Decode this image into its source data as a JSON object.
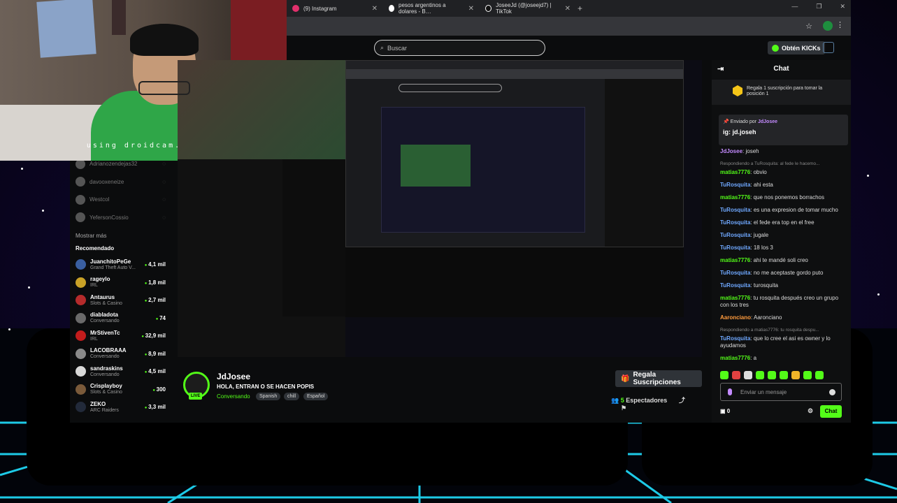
{
  "webcam": {
    "caption": "using droidcam.app"
  },
  "browser": {
    "tabs": [
      {
        "label": "(9) Instagram",
        "icon": "instagram-icon"
      },
      {
        "label": "pesos argentinos a dolares - B…",
        "icon": "google-icon"
      },
      {
        "label": "JoseeJd (@joseejd7) | TikTok",
        "icon": "tiktok-icon"
      }
    ],
    "new_tab": "+"
  },
  "header": {
    "search_placeholder": "Buscar",
    "kicks_label": "Obtén KICKs"
  },
  "sidebar": {
    "following": [
      {
        "name": "Adrianozendejas32"
      },
      {
        "name": "davooxeneize"
      },
      {
        "name": "Westcol"
      },
      {
        "name": "YefersonCossio"
      }
    ],
    "show_more": "Mostrar más",
    "recommended_title": "Recomendado",
    "recommended": [
      {
        "name": "JuanchitoPeGe",
        "category": "Grand Theft Auto V...",
        "viewers": "4,1 mil",
        "color": "#3a5fa0"
      },
      {
        "name": "rageylo",
        "category": "IRL",
        "viewers": "1,8 mil",
        "color": "#c9a227"
      },
      {
        "name": "Antaurus",
        "category": "Slots & Casino",
        "viewers": "2,7 mil",
        "color": "#b52b2b"
      },
      {
        "name": "diabladota",
        "category": "Conversando",
        "viewers": "74",
        "color": "#6a6a6a"
      },
      {
        "name": "MrStivenTc",
        "category": "IRL",
        "viewers": "32,9 mil",
        "color": "#c21c1c"
      },
      {
        "name": "LACOBRAAA",
        "category": "Conversando",
        "viewers": "8,9 mil",
        "color": "#8a8a8a"
      },
      {
        "name": "sandraskins",
        "category": "Conversando",
        "viewers": "4,5 mil",
        "color": "#d9d9d9"
      },
      {
        "name": "Crisplayboy",
        "category": "Slots & Casino",
        "viewers": "300",
        "color": "#7a5a3a"
      },
      {
        "name": "ZEKO",
        "category": "ARC Raiders",
        "viewers": "3,3 mil",
        "color": "#222a3a"
      }
    ]
  },
  "streamer": {
    "name": "JdJosee",
    "title": "HOLA, ENTRAN O SE HACEN POPIS",
    "category": "Conversando",
    "tags": [
      "Spanish",
      "chill",
      "Español"
    ],
    "live_badge": "LIVE",
    "gift_button": "Regala Suscripciones",
    "viewers_count": "5",
    "viewers_label": "Espectadores"
  },
  "chat": {
    "title": "Chat",
    "gift_prompt": "Regala 1 suscripción para tomar la posición 1",
    "pinned": {
      "sent_by_label": "Enviado por",
      "user": "JdJosee",
      "message": "ig: jd.joseh"
    },
    "messages": [
      {
        "type": "msg",
        "user": "JdJosee",
        "color": "#c48bff",
        "text": ": joseh"
      },
      {
        "type": "reply",
        "text": "Respondiendo a TuRosquita: al fede le hacemo..."
      },
      {
        "type": "msg",
        "user": "matias7776",
        "color": "#53fc18",
        "text": ": obvio"
      },
      {
        "type": "msg",
        "user": "TuRosquita",
        "color": "#6fa8ff",
        "text": ": ahi esta"
      },
      {
        "type": "msg",
        "user": "matias7776",
        "color": "#53fc18",
        "text": ": que nos ponemos borrachos"
      },
      {
        "type": "msg",
        "user": "TuRosquita",
        "color": "#6fa8ff",
        "text": ": es una expresion de tomar mucho"
      },
      {
        "type": "msg",
        "user": "TuRosquita",
        "color": "#6fa8ff",
        "text": ": el fede era top en el free"
      },
      {
        "type": "msg",
        "user": "TuRosquita",
        "color": "#6fa8ff",
        "text": ": jugale"
      },
      {
        "type": "msg",
        "user": "TuRosquita",
        "color": "#6fa8ff",
        "text": ": 18 los 3"
      },
      {
        "type": "msg",
        "user": "matias7776",
        "color": "#53fc18",
        "text": ": ahi te mandé soli creo"
      },
      {
        "type": "msg",
        "user": "TuRosquita",
        "color": "#6fa8ff",
        "text": ": no me aceptaste gordo puto"
      },
      {
        "type": "msg",
        "user": "TuRosquita",
        "color": "#6fa8ff",
        "text": ": turosquita"
      },
      {
        "type": "msg",
        "user": "matias7776",
        "color": "#53fc18",
        "text": ": tu rosquita después creo un grupo con los tres"
      },
      {
        "type": "msg",
        "user": "Aaronciano",
        "color": "#ff9b3d",
        "text": ": Aaronciano"
      },
      {
        "type": "reply",
        "text": "Respondiendo a matias7776: tu rosquita despu..."
      },
      {
        "type": "msg",
        "user": "TuRosquita",
        "color": "#6fa8ff",
        "text": ": que lo cree el asi es owner y lo ayudamos"
      },
      {
        "type": "msg",
        "user": "matias7776",
        "color": "#53fc18",
        "text": ": a"
      }
    ],
    "input_placeholder": "Enviar un mensaje",
    "points": "0",
    "send_label": "Chat"
  }
}
